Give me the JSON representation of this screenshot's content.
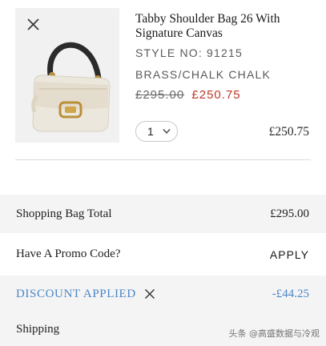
{
  "product": {
    "title": "Tabby Shoulder Bag 26 With Signature Canvas",
    "style": "STYLE NO: 91215",
    "color": "BRASS/CHALK CHALK",
    "original_price": "£295.00",
    "sale_price": "£250.75",
    "quantity": "1",
    "line_total": "£250.75"
  },
  "summary": {
    "bag_total_label": "Shopping Bag Total",
    "bag_total_value": "£295.00",
    "promo_label": "Have A Promo Code?",
    "apply_label": "APPLY",
    "discount_label": "DISCOUNT APPLIED",
    "discount_value": "-£44.25",
    "shipping_label": "Shipping"
  },
  "watermark": "头条 @高盛数据与冷观",
  "colors": {
    "sale": "#c0392b",
    "discount": "#4a86c8",
    "summary_bg": "#f4f4f4"
  }
}
